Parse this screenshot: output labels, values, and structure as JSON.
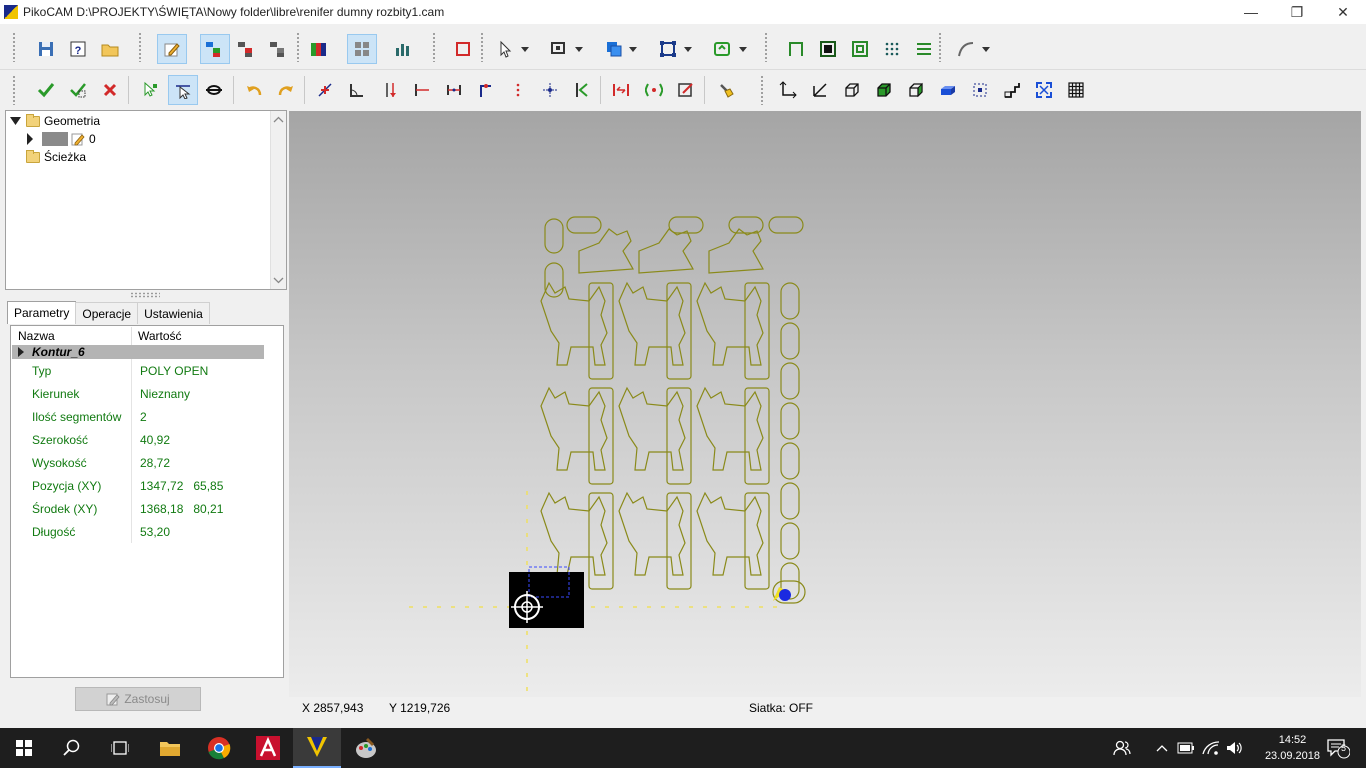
{
  "window": {
    "title": "PikoCAM  D:\\PROJEKTY\\ŚWIĘTA\\Nowy folder\\libre\\renifer dumny rozbity1.cam",
    "minimize": "—",
    "restore": "❐",
    "close": "✕"
  },
  "tree": {
    "geometry_label": "Geometria",
    "layer_label": "0",
    "path_label": "Ścieżka"
  },
  "tabs": [
    "Parametry",
    "Operacje",
    "Ustawienia"
  ],
  "properties": {
    "col_name": "Nazwa",
    "col_value": "Wartość",
    "group": "Kontur_6",
    "rows": [
      {
        "name": "Typ",
        "value": "POLY OPEN"
      },
      {
        "name": "Kierunek",
        "value": "Nieznany"
      },
      {
        "name": "Ilość segmentów",
        "value": "2"
      },
      {
        "name": "Szerokość",
        "value": "40,92"
      },
      {
        "name": "Wysokość",
        "value": "28,72"
      },
      {
        "name": "Pozycja (XY)",
        "value": "1347,72   65,85"
      },
      {
        "name": "Środek (XY)",
        "value": "1368,18   80,21"
      },
      {
        "name": "Długość",
        "value": "53,20"
      }
    ],
    "apply_label": "Zastosuj"
  },
  "status": {
    "x": "X 2857,943",
    "y": "Y 1219,726",
    "grid": "Siatka: OFF"
  },
  "taskbar": {
    "time": "14:52",
    "date": "23.09.2018",
    "notifications": "5"
  },
  "colors": {
    "contour": "#8a8a1a",
    "accent_blue": "#1a6fd6",
    "ok_green": "#2a9a2a",
    "cancel_red": "#d22a2a"
  }
}
